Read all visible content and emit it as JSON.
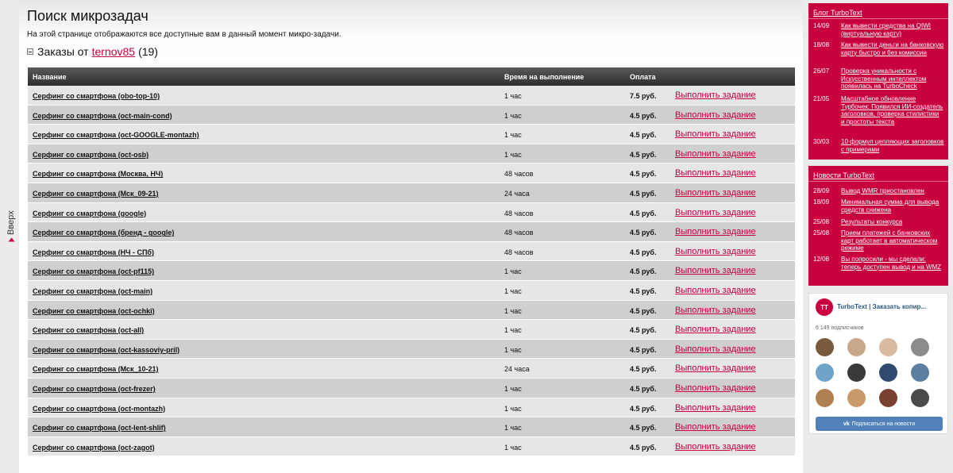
{
  "scroll_up": {
    "label": "Вверх"
  },
  "page": {
    "title": "Поиск микрозадач",
    "description": "На этой странице отображаются все доступные вам в данный момент микро-задачи.",
    "orders_prefix": "Заказы от",
    "author": "ternov85",
    "orders_count": "(19)"
  },
  "table": {
    "headers": {
      "name": "Название",
      "time": "Время на выполнение",
      "pay": "Оплата"
    },
    "action_label": "Выполнить задание",
    "rows": [
      {
        "name": "Серфинг со смартфона (obo-top-10)",
        "time": "1 час",
        "pay": "7.5 руб."
      },
      {
        "name": "Серфинг со смартфона (oct-main-cond)",
        "time": "1 час",
        "pay": "4.5 руб."
      },
      {
        "name": "Серфинг со смартфона (oct-GOOGLE-montazh)",
        "time": "1 час",
        "pay": "4.5 руб."
      },
      {
        "name": "Серфинг со смартфона (oct-osb)",
        "time": "1 час",
        "pay": "4.5 руб."
      },
      {
        "name": "Серфинг со смартфона (Москва, НЧ)",
        "time": "48 часов",
        "pay": "4.5 руб."
      },
      {
        "name": "Серфинг со смартфона (Мск_09-21)",
        "time": "24 часа",
        "pay": "4.5 руб."
      },
      {
        "name": "Серфинг со смартфона (google)",
        "time": "48 часов",
        "pay": "4.5 руб."
      },
      {
        "name": "Серфинг со смартфона (бренд - google)",
        "time": "48 часов",
        "pay": "4.5 руб."
      },
      {
        "name": "Серфинг со смартфона (НЧ - СПб)",
        "time": "48 часов",
        "pay": "4.5 руб."
      },
      {
        "name": "Серфинг со смартфона (oct-pf115)",
        "time": "1 час",
        "pay": "4.5 руб."
      },
      {
        "name": "Серфинг со смартфона (oct-main)",
        "time": "1 час",
        "pay": "4.5 руб."
      },
      {
        "name": "Серфинг со смартфона (oct-ochki)",
        "time": "1 час",
        "pay": "4.5 руб."
      },
      {
        "name": "Серфинг со смартфона (oct-all)",
        "time": "1 час",
        "pay": "4.5 руб."
      },
      {
        "name": "Серфинг со смартфона (oct-kassoviy-pril)",
        "time": "1 час",
        "pay": "4.5 руб."
      },
      {
        "name": "Серфинг со смартфона (Мск_10-21)",
        "time": "24 часа",
        "pay": "4.5 руб."
      },
      {
        "name": "Серфинг со смартфона (oct-frezer)",
        "time": "1 час",
        "pay": "4.5 руб."
      },
      {
        "name": "Серфинг со смартфона (oct-montazh)",
        "time": "1 час",
        "pay": "4.5 руб."
      },
      {
        "name": "Серфинг со смартфона (oct-lent-shlif)",
        "time": "1 час",
        "pay": "4.5 руб."
      },
      {
        "name": "Серфинг со смартфона (oct-zagot)",
        "time": "1 час",
        "pay": "4.5 руб."
      }
    ]
  },
  "blog": {
    "title": "Блог TurboText",
    "items": [
      {
        "date": "14/09",
        "text": "Как вывести средства на QIWI (виртуальную карту)"
      },
      {
        "date": "18/08",
        "text": "Как вывести деньги на банковскую карту быстро и без комиссии"
      },
      {
        "date": "26/07",
        "text": "Проверка уникальности с Искусственным интеллектом появилась на TurboCheck"
      },
      {
        "date": "21/05",
        "text": "Масштабное обновление Турбочек: Появился ИИ-создатель заголовков, проверка стилистики и простоты текста"
      },
      {
        "date": "30/03",
        "text": "10 формул цепляющих заголовков с примерами"
      }
    ]
  },
  "news": {
    "title": "Новости TurboText",
    "items": [
      {
        "date": "28/09",
        "text": "Вывод WMR приостановлен"
      },
      {
        "date": "18/09",
        "text": "Минимальная сумма для вывода средств снижена"
      },
      {
        "date": "25/08",
        "text": "Результаты конкурса"
      },
      {
        "date": "25/08",
        "text": "Прием платежей с банковских карт работает в автоматическом режиме"
      },
      {
        "date": "12/08",
        "text": "Вы попросили - мы сделали: теперь доступен вывод и на WMZ"
      }
    ]
  },
  "vk": {
    "logo": "TT",
    "name": "TurboText | Заказать копир...",
    "subscribers": "6 149 подписчиков",
    "button": "Подписаться на новости",
    "button_icon": "vk-icon",
    "avatar_colors": [
      "#7a5a3c",
      "#c9a88a",
      "#d9b9a0",
      "#8c8c8c",
      "#6fa4c8",
      "#3a3a3a",
      "#2f4a6e",
      "#5a7fa0",
      "#b08050",
      "#c89a6a",
      "#7a4030",
      "#4a4a4a"
    ]
  },
  "colors": {
    "accent": "#c8003e",
    "vk_blue": "#5181b8"
  }
}
